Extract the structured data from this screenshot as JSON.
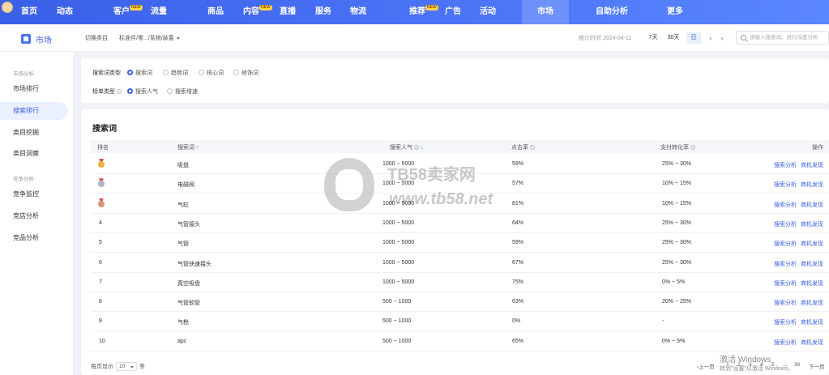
{
  "topnav": {
    "items": [
      "首页",
      "动态",
      "客户",
      "流量",
      "商品",
      "内容",
      "直播",
      "服务",
      "物流",
      "推荐",
      "广告",
      "活动",
      "市场",
      "自助分析",
      "更多"
    ],
    "new_badge": "NEW",
    "active": "市场"
  },
  "sidebar": {
    "title": "市场",
    "groups": [
      "市场分析",
      "竞争分析"
    ],
    "items": [
      "市场排行",
      "搜索排行",
      "类目挖掘",
      "类目洞察",
      "竞争监控",
      "竞店分析",
      "竞品分析"
    ],
    "active": "搜索排行"
  },
  "header": {
    "switch_category": "切换类目",
    "category_path": "标准件/零.../系统/装置",
    "stat_time": "统计时间 2024-04-11",
    "date_buttons": [
      "7天",
      "30天",
      "日"
    ],
    "active_date": "日",
    "prev_icon": "‹",
    "next_icon": "›",
    "search_placeholder": "请输入搜索词，进行深度分析"
  },
  "filters": {
    "type_label": "搜索词类型",
    "type_options": [
      "搜索词",
      "趋势词",
      "核心词",
      "修饰词"
    ],
    "type_selected": "搜索词",
    "rank_label": "榜单类型",
    "rank_options": [
      "搜索人气",
      "搜索增速"
    ],
    "rank_selected": "搜索人气"
  },
  "table": {
    "title": "搜索词",
    "columns": {
      "rank": "排名",
      "keyword": "搜索词",
      "popularity": "搜索人气",
      "ctr": "点击率",
      "conversion": "支付转化率",
      "action": "操作"
    },
    "rows": [
      {
        "rank": "1",
        "keyword": "吸盘",
        "popularity": "1000 ~ 5000",
        "ctr": "59%",
        "conversion": "25% ~ 30%"
      },
      {
        "rank": "2",
        "keyword": "电磁阀",
        "popularity": "1000 ~ 5000",
        "ctr": "57%",
        "conversion": "10% ~ 15%"
      },
      {
        "rank": "3",
        "keyword": "气缸",
        "popularity": "1000 ~ 5000",
        "ctr": "81%",
        "conversion": "10% ~ 15%"
      },
      {
        "rank": "4",
        "keyword": "气管接头",
        "popularity": "1000 ~ 5000",
        "ctr": "64%",
        "conversion": "25% ~ 30%"
      },
      {
        "rank": "5",
        "keyword": "气管",
        "popularity": "1000 ~ 5000",
        "ctr": "59%",
        "conversion": "25% ~ 30%"
      },
      {
        "rank": "6",
        "keyword": "气管快速接头",
        "popularity": "1000 ~ 5000",
        "ctr": "67%",
        "conversion": "25% ~ 30%"
      },
      {
        "rank": "7",
        "keyword": "真空吸盘",
        "popularity": "1000 ~ 5000",
        "ctr": "75%",
        "conversion": "0% ~ 5%"
      },
      {
        "rank": "8",
        "keyword": "气管软管",
        "popularity": "500 ~ 1000",
        "ctr": "63%",
        "conversion": "20% ~ 25%"
      },
      {
        "rank": "9",
        "keyword": "气枪",
        "popularity": "500 ~ 1000",
        "ctr": "0%",
        "conversion": "-"
      },
      {
        "rank": "10",
        "keyword": "apc",
        "popularity": "500 ~ 1000",
        "ctr": "65%",
        "conversion": "0% ~ 5%"
      }
    ],
    "action_analyze": "搜索分析",
    "action_opportunity": "商机发现",
    "medal_colors": [
      "#e9b43a",
      "#a9b4c6",
      "#d9957a"
    ]
  },
  "pagination": {
    "per_page_label": "每页显示",
    "per_page_value": "10",
    "per_page_unit": "条",
    "prev": "‹上一页",
    "pages": [
      "1",
      "2",
      "3",
      "4",
      "5",
      "...",
      "30"
    ],
    "next": "下一页"
  },
  "watermark": {
    "brand": "TB58卖家网",
    "url": "www.tb58.net"
  },
  "windows_activation": {
    "title": "激活 Windows",
    "subtitle": "转到\"设置\"以激活 Windows。"
  }
}
